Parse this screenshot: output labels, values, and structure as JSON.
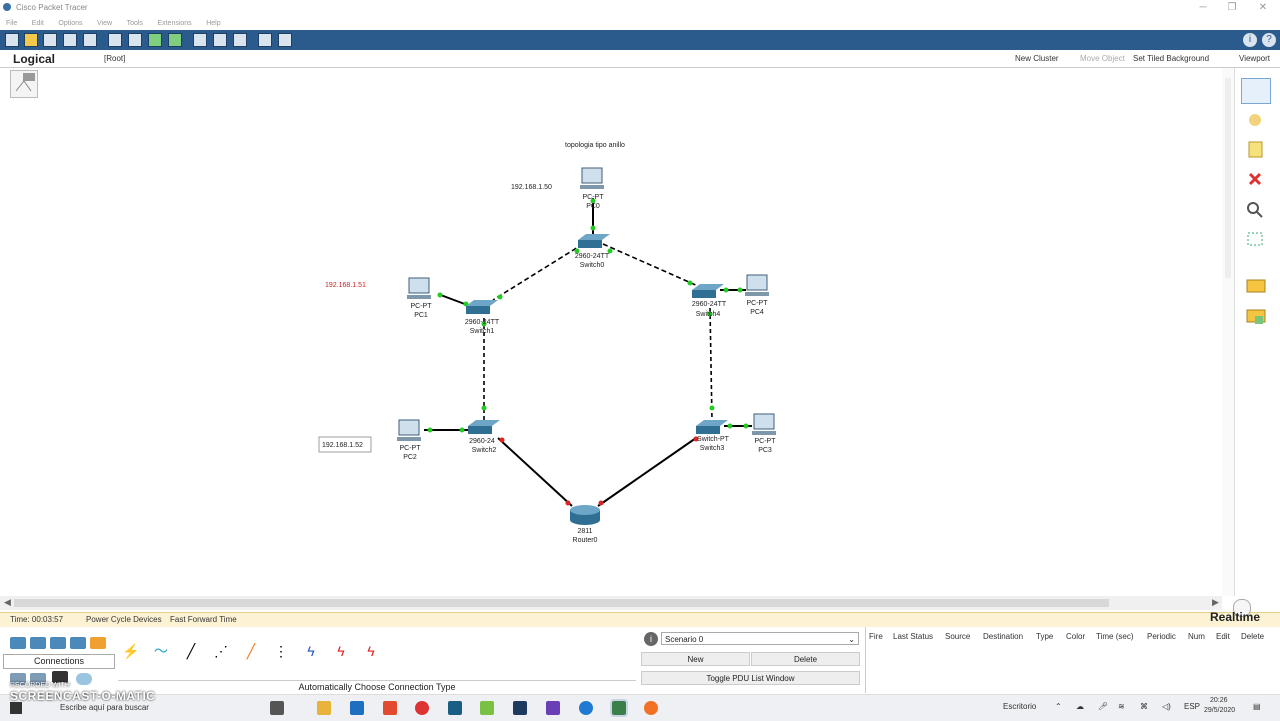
{
  "window": {
    "title": "Cisco Packet Tracer",
    "controls": [
      "─",
      "❐",
      "✕"
    ]
  },
  "menu": [
    "File",
    "Edit",
    "Options",
    "View",
    "Tools",
    "Extensions",
    "Help"
  ],
  "workspace_bar": {
    "mode": "Logical",
    "root": "[Root]",
    "new_cluster": "New Cluster",
    "move_object": "Move Object",
    "set_background": "Set Tiled Background",
    "viewport": "Viewport"
  },
  "topology": {
    "note": "topologia tipo anillo",
    "ip_pc0": "192.168.1.50",
    "ip_pc1": "192.168.1.51",
    "ip_pc2": "192.168.1.52",
    "devices": {
      "pc0": {
        "model": "PC-PT",
        "name": "PC0"
      },
      "pc1": {
        "model": "PC-PT",
        "name": "PC1"
      },
      "pc2": {
        "model": "PC-PT",
        "name": "PC2"
      },
      "pc3": {
        "model": "PC-PT",
        "name": "PC3"
      },
      "pc4": {
        "model": "PC-PT",
        "name": "PC4"
      },
      "switch0": {
        "model": "2960-24TT",
        "name": "Switch0"
      },
      "switch1": {
        "model": "2960-24TT",
        "name": "Switch1"
      },
      "switch2": {
        "model": "2960-24",
        "name": "Switch2"
      },
      "switch3": {
        "model": "Switch-PT",
        "name": "Switch3"
      },
      "switch4": {
        "model": "2960-24TT",
        "name": "Switch4"
      },
      "router0": {
        "model": "2811",
        "name": "Router0"
      }
    }
  },
  "status": {
    "time": "Time: 00:03:57",
    "power_cycle": "Power Cycle Devices",
    "fast_forward": "Fast Forward Time",
    "mode": "Realtime"
  },
  "bottom": {
    "category": "Connections",
    "connection_type": "Automatically Choose Connection Type",
    "scenario": "Scenario 0",
    "new": "New",
    "delete": "Delete",
    "toggle_pdu": "Toggle PDU List Window",
    "pdu_columns": [
      "Fire",
      "Last Status",
      "Source",
      "Destination",
      "Type",
      "Color",
      "Time (sec)",
      "Periodic",
      "Num",
      "Edit",
      "Delete"
    ]
  },
  "taskbar": {
    "search": "Escribe aquí para buscar",
    "desktop": "Escritorio",
    "lang": "ESP",
    "clock_time": "20:26",
    "clock_date": "29/5/2020"
  },
  "watermark": {
    "recorded": "RECORDED WITH",
    "brand": "SCREENCAST-O-MATIC"
  },
  "colors": {
    "toolbar": "#2b5a8c",
    "status_bg": "#fdf3d4",
    "link_up": "#22cc22",
    "link_down": "#dd2222",
    "ip_red": "#cc2222"
  }
}
